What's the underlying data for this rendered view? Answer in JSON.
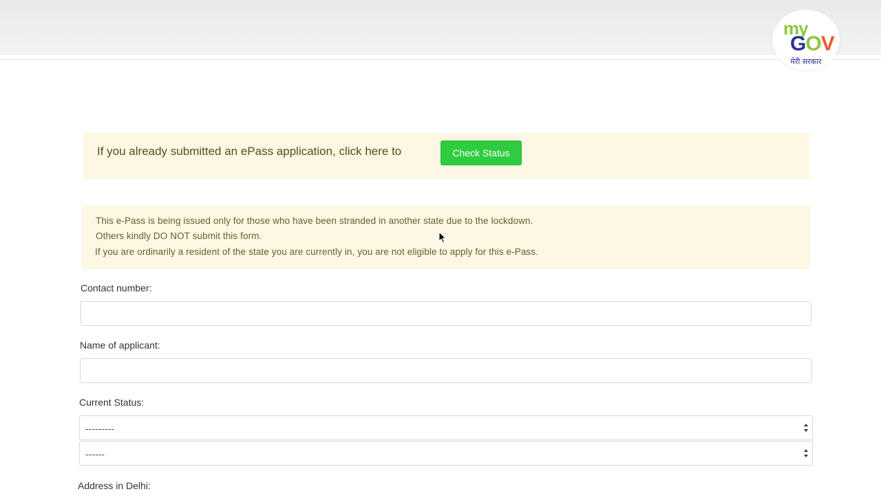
{
  "logo": {
    "my": "my",
    "gov_g": "G",
    "gov_o": "O",
    "gov_v": "V",
    "subtitle": "मेरी सरकार"
  },
  "status_banner": {
    "text": "If you already submitted an ePass application, click here to",
    "button_label": "Check Status"
  },
  "notice": {
    "line1": "This e-Pass is being issued only for those who have been stranded in another state due to the lockdown.",
    "line2": "Others kindly DO NOT submit this form.",
    "line3": "If you are ordinarily a resident of the state you are currently in, you are not eligible to apply for this e-Pass."
  },
  "form": {
    "contact_label": "Contact number:",
    "contact_value": "",
    "name_label": "Name of applicant:",
    "name_value": "",
    "status_label": "Current Status:",
    "status_select_1": "---------",
    "status_select_2": "------",
    "address_label": "Address in Delhi:"
  },
  "colors": {
    "accent_green": "#2ecc40",
    "alert_bg": "#fcf8e3"
  }
}
